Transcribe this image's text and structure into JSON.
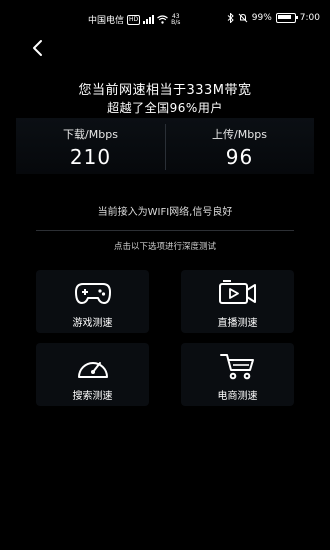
{
  "status_bar": {
    "carrier": "中国电信",
    "hd": "HD",
    "net_speed_value": "43",
    "net_speed_unit": "B/s",
    "battery": "99%",
    "time": "7:00"
  },
  "summary": {
    "headline": "您当前网速相当于333M带宽",
    "subline": "超越了全国96%用户"
  },
  "speed": {
    "download_label": "下载/Mbps",
    "download_value": "210",
    "upload_label": "上传/Mbps",
    "upload_value": "96"
  },
  "connection_text": "当前接入为WIFI网络,信号良好",
  "hint_text": "点击以下选项进行深度测试",
  "tests": [
    {
      "label": "游戏测速",
      "icon": "gamepad-icon"
    },
    {
      "label": "直播测速",
      "icon": "video-play-icon"
    },
    {
      "label": "搜索测速",
      "icon": "speedometer-icon"
    },
    {
      "label": "电商测速",
      "icon": "shopping-cart-icon"
    }
  ],
  "colors": {
    "background": "#000000",
    "tile_background": "#0a0d11",
    "panel_background": "#0b0f14"
  }
}
